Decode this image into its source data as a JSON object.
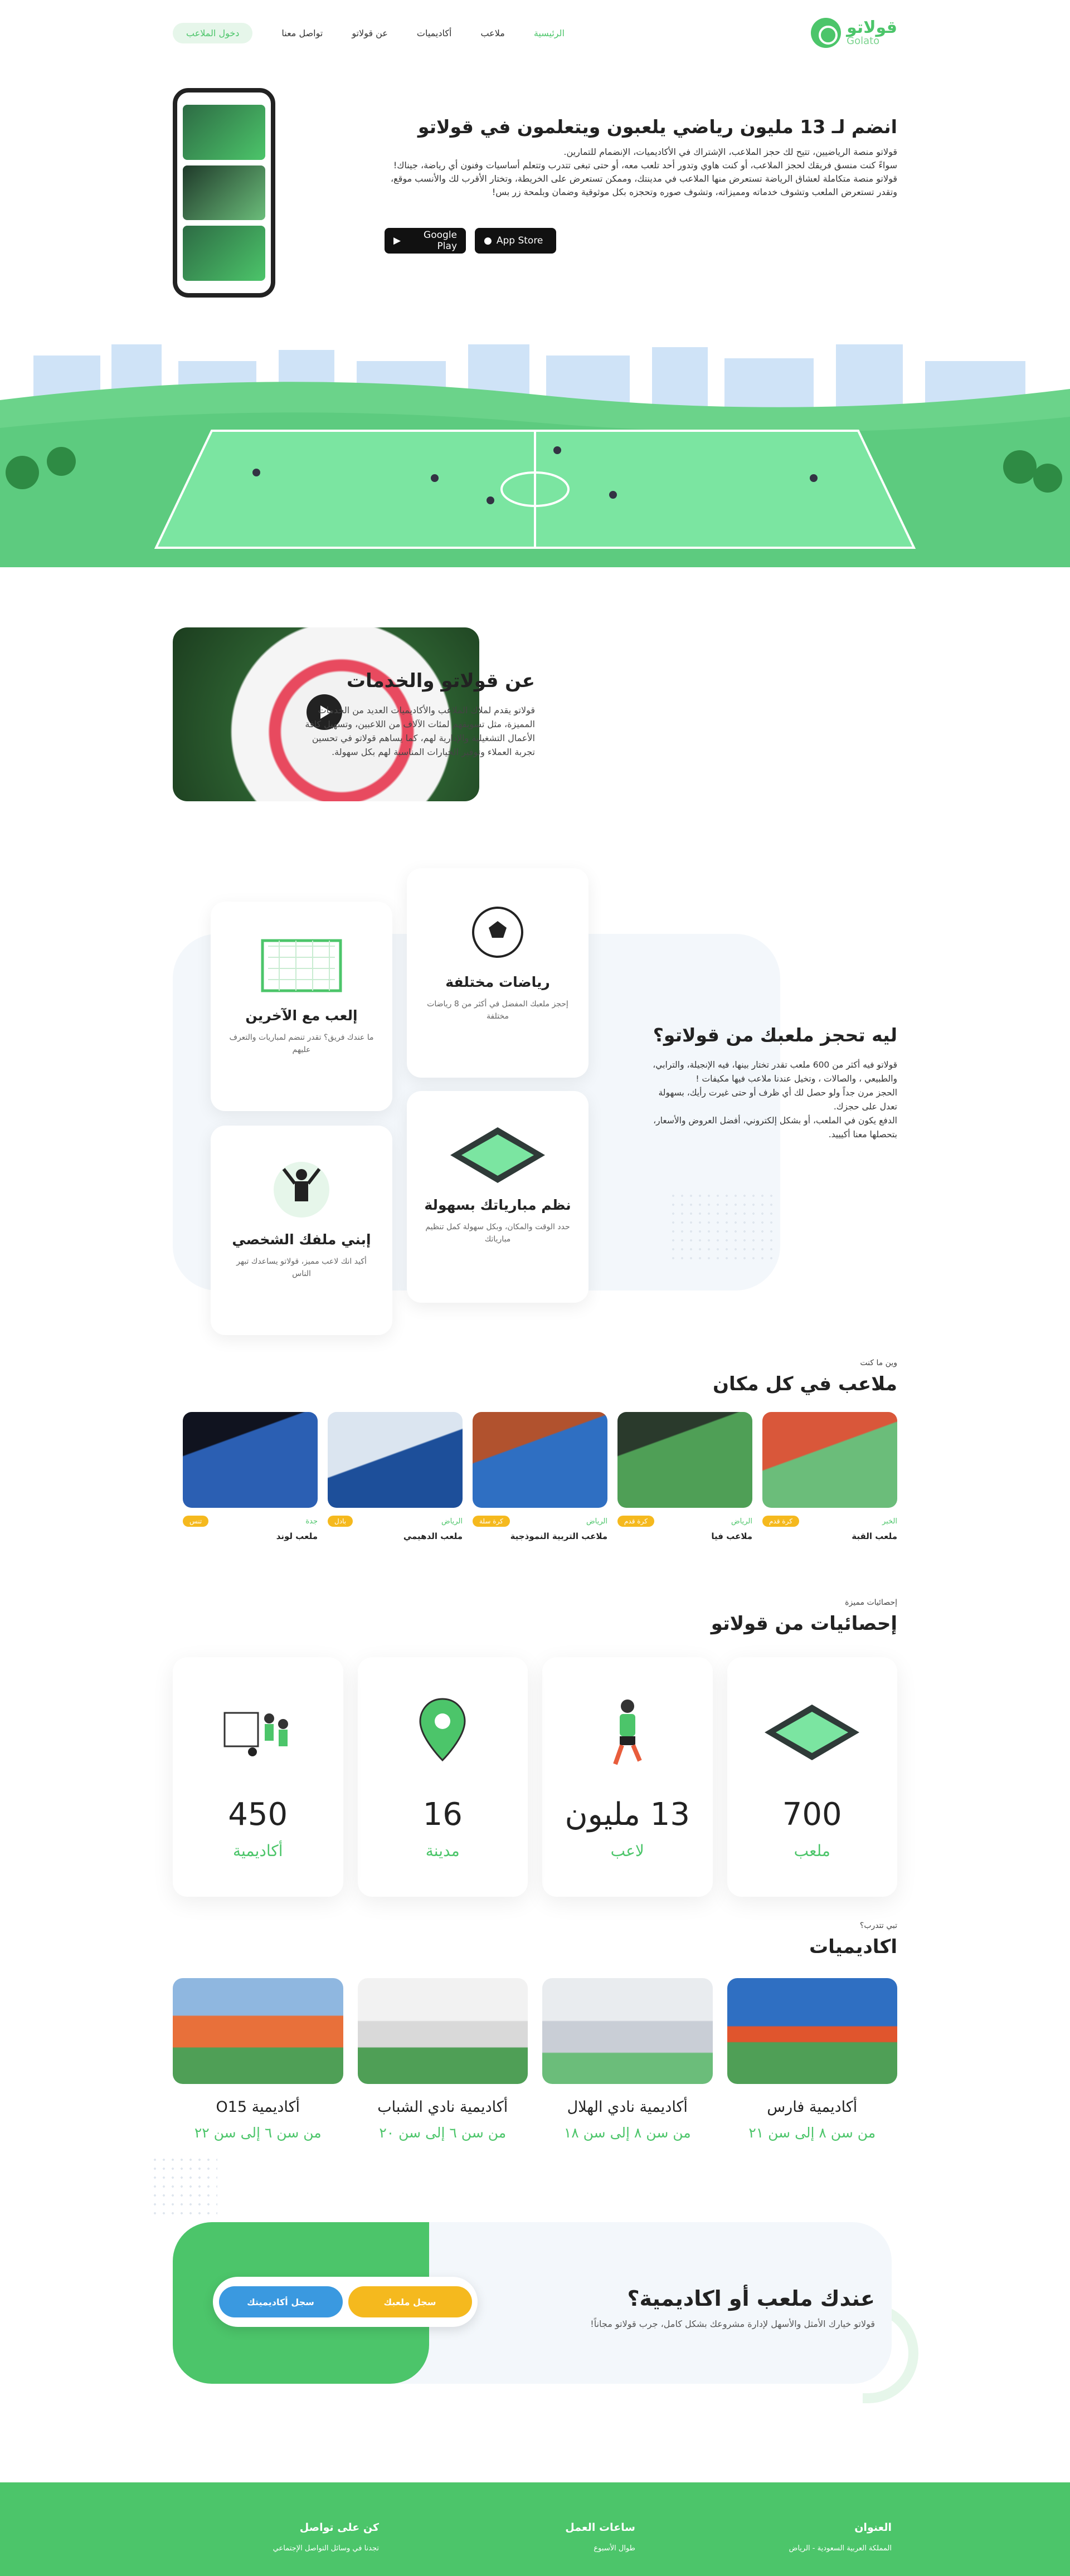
{
  "nav": {
    "logo_ar": "قولاتو",
    "logo_en": "Golato",
    "items": [
      "الرئيسية",
      "ملاعب",
      "أكاديميات",
      "عن قولاتو",
      "تواصل معنا"
    ],
    "login": "دخول الملاعب"
  },
  "hero": {
    "title": "انضم لـ 13 مليون رياضي يلعبون ويتعلمون في قولاتو",
    "p1": "قولاتو منصة الرياضيين، تتيح لك حجز الملاعب، الإشتراك في الأكاديميات، الإنضمام للتمارين.",
    "p2": "سواءً كنت منسق فريقك لحجز الملاعب، أو كنت هاوي وتدور أحد تلعب معه، أو حتى تبغى تتدرب وتتعلم أساسيات وفنون أي رياضة، جيناك!",
    "p3": "قولاتو منصة متكاملة لعشاق الرياضة تستعرض منها الملاعب في مدينتك، وممكن تستعرض على الخريطة، وتختار الأقرب لك والأنسب موقع، وتقدر تستعرض الملعب وتشوف خدماته ومميزاته، وتشوف صوره وتحجزه بكل موثوقية وضمان وبلمحة زر بس!",
    "app_store": "App Store",
    "google_play": "Google Play"
  },
  "about": {
    "title": "عن قولاتو والخدمات",
    "text": "قولاتو يقدم لملاك الملاعب والأكاديميات العديد من الخدمات المميزة، مثل تسويقهم لمئات الآلاف من اللاعبين، وتسهيل كافة الأعمال التشغيلية والإدارية لهم، كما يساهم قولاتو في تحسين تجربة العملاء وتوفير الخيارات المناسبة لهم بكل سهولة."
  },
  "why": {
    "title": "ليه تحجز ملعبك من قولاتو؟",
    "p1": "قولاتو فيه أكثر من 600 ملعب تقدر تختار بينها، فيه الإنجيلة، والترابي، والطبيعي ، والصالات ، وتخيل عندنا ملاعب فيها مكيفات !",
    "p2": "الحجز مرن جداً ولو حصل لك أي ظرف أو حتى غيرت رأيك، بسهولة تعدل على حجزك.",
    "p3": "الدفع يكون في الملعب، أو بشكل إلكتروني، أفضل العروض والأسعار، بتحصلها معنا أكيييد.",
    "cards": [
      {
        "title": "رياضات مختلفة",
        "text": "إحجز ملعبك المفضل في أكثر من 8 رياضات مختلفة"
      },
      {
        "title": "إلعب مع الآخرين",
        "text": "ما عندك فريق؟ تقدر تنضم لمباريات والتعرف عليهم"
      },
      {
        "title": "نظم مبارياتك بسهولة",
        "text": "حدد الوقت والمكان، وبكل سهولة كمل تنظيم مبارياتك"
      },
      {
        "title": "إبني ملفك الشخصي",
        "text": "أكيد انك لاعب مميز، قولاتو يساعدك تبهر الناس"
      }
    ]
  },
  "pitches": {
    "sub": "وين ما كنت",
    "title": "ملاعب في كل مكان",
    "items": [
      {
        "city": "الخبر",
        "badge": "كرة قدم",
        "name": "ملعب القبة"
      },
      {
        "city": "الرياض",
        "badge": "كرة قدم",
        "name": "ملاعب فيا"
      },
      {
        "city": "الرياض",
        "badge": "كرة سلة",
        "name": "ملاعب التربية النموذجية"
      },
      {
        "city": "الرياض",
        "badge": "بادل",
        "name": "ملعب الدهيمي"
      },
      {
        "city": "جدة",
        "badge": "تنس",
        "name": "ملعب لوند"
      }
    ]
  },
  "stats": {
    "sub": "إحصائيات مميزة",
    "title": "إحصائيات من قولاتو",
    "items": [
      {
        "num": "700",
        "label": "ملعب",
        "icon": "pitch-icon"
      },
      {
        "num": "13 مليون",
        "label": "لاعب",
        "icon": "player-icon"
      },
      {
        "num": "16",
        "label": "مدينة",
        "icon": "location-pin-icon"
      },
      {
        "num": "450",
        "label": "أكاديمية",
        "icon": "academy-icon"
      }
    ]
  },
  "academies": {
    "sub": "تبي تتدرب؟",
    "title": "اكاديميات",
    "items": [
      {
        "name": "أكاديمية فارس",
        "age": "من سن ٨ إلى سن ٢١"
      },
      {
        "name": "أكاديمية نادي الهلال",
        "age": "من سن ٨ إلى سن ١٨"
      },
      {
        "name": "أكاديمية نادي الشباب",
        "age": "من سن ٦ إلى سن ٢٠"
      },
      {
        "name": "أكاديمية O15",
        "age": "من سن ٦ إلى سن ٢٢"
      }
    ]
  },
  "cta": {
    "title": "عندك ملعب أو اكاديمية؟",
    "text": "قولاتو خيارك الأمثل والأسهل لإدارة مشروعك بشكل كامل، جرب قولاتو مجاناً!",
    "btn_pitch": "سجل ملعبك",
    "btn_academy": "سجل أكاديميتك"
  },
  "footer": {
    "address_title": "العنوان",
    "address": "المملكة العربية السعودية - الرياض",
    "hours_title": "ساعات العمل",
    "hours": "طوال الأسبوع",
    "contact_title": "كن على تواصل",
    "contact": "تجدنا في وسائل التواصل الإجتماعي"
  },
  "colors": {
    "brand": "#4CC56A",
    "yellow": "#F5B91E",
    "blue": "#3A99E0"
  }
}
